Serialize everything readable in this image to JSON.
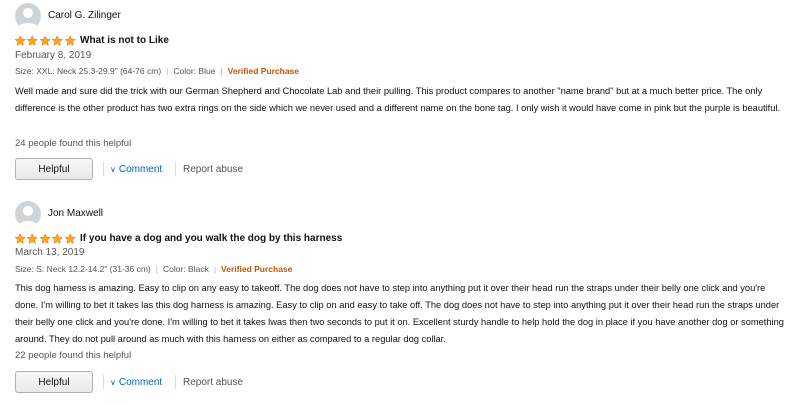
{
  "colors": {
    "star": "#ffa41c",
    "star_outline": "#de7921",
    "verified": "#c45500",
    "link": "#0066c0"
  },
  "reviews": [
    {
      "author": "Carol G. Zilinger",
      "rating": 5,
      "title": "What is not to Like",
      "date": "February 8, 2019",
      "size": "Size: XXL: Neck 25.3-29.9\" (64-76 cm)",
      "color": "Color: Blue",
      "verified": "Verified Purchase",
      "text": "Well made and sure did the trick with our German Shepherd and Chocolate Lab and their pulling. This product compares to another \"name brand\" but at a much better price. The only difference is the other product has two extra rings on the side which we never used and a different name on the bone tag. I only wish it would have come in pink but the purple is beautiful.",
      "helpful_count": "24 people found this helpful",
      "helpful_label": "Helpful",
      "comment_label": "Comment",
      "report_label": "Report abuse"
    },
    {
      "author": "Jon Maxwell",
      "rating": 5,
      "title": "If you have a dog and you walk the dog by this harness",
      "date": "March 13, 2019",
      "size": "Size: S: Neck 12.2-14.2\" (31-36 cm)",
      "color": "Color: Black",
      "verified": "Verified Purchase",
      "text": "This dog harness is amazing. Easy to clip on any easy to takeoff. The dog does not have to step into anything put it over their head run the straps under their belly one click and you're done. I'm willing to bet it takes las this dog harness is amazing. Easy to clip on and easy to take off. The dog does not have to step into anything put it over their head run the straps under their belly one click and you're done. I'm willing to bet it takes lwas then two seconds to put it on. Excellent sturdy handle to help hold the dog in place if you have another dog or something around. They do not pull around as much with this harness on either as compared to a regular dog collar.",
      "helpful_count": "22 people found this helpful",
      "helpful_label": "Helpful",
      "comment_label": "Comment",
      "report_label": "Report abuse"
    }
  ]
}
